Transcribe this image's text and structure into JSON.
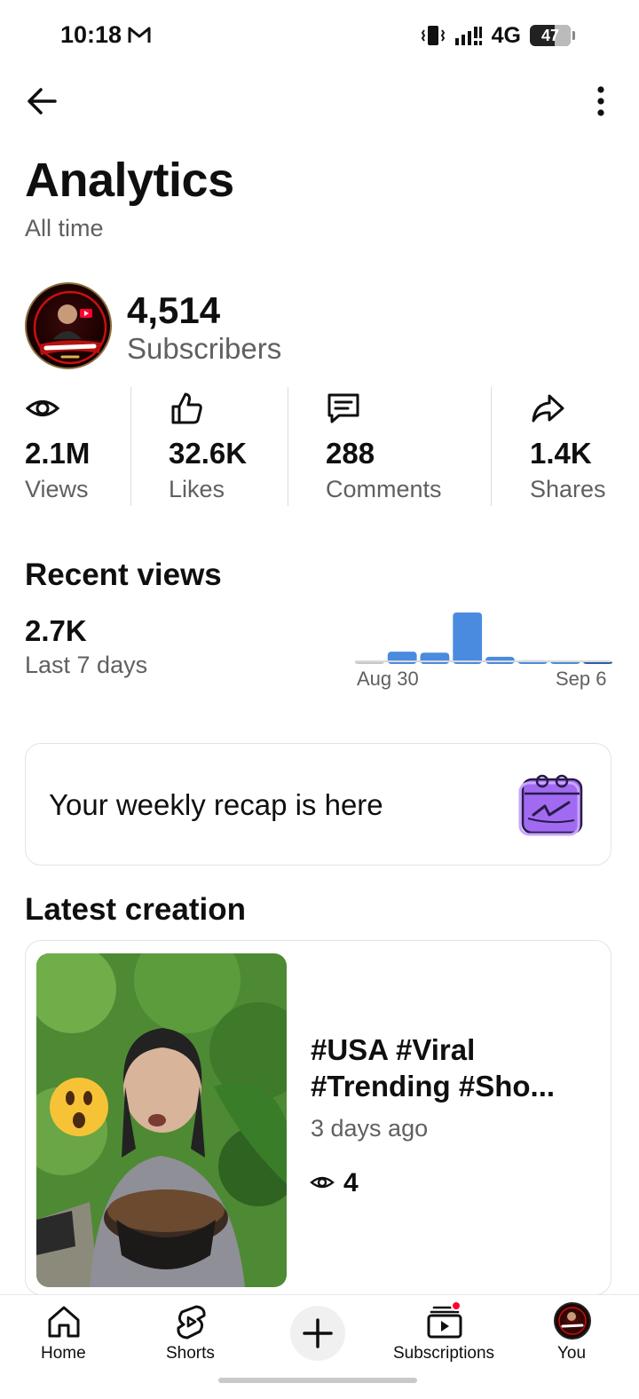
{
  "status_bar": {
    "time": "10:18",
    "network": "4G",
    "battery": "47"
  },
  "page": {
    "title": "Analytics",
    "subtitle": "All time"
  },
  "channel": {
    "subscribers": "4,514",
    "subscribers_label": "Subscribers"
  },
  "metrics": [
    {
      "icon": "eye-icon",
      "value": "2.1M",
      "label": "Views"
    },
    {
      "icon": "thumbs-up-icon",
      "value": "32.6K",
      "label": "Likes"
    },
    {
      "icon": "comment-icon",
      "value": "288",
      "label": "Comments"
    },
    {
      "icon": "share-icon",
      "value": "1.4K",
      "label": "Shares"
    }
  ],
  "recent_views": {
    "title": "Recent views",
    "count": "2.7K",
    "period": "Last 7 days"
  },
  "chart_data": {
    "type": "bar",
    "categories": [
      "1",
      "2",
      "3",
      "4",
      "5",
      "6",
      "7",
      "8"
    ],
    "values": [
      4,
      24,
      22,
      100,
      14,
      7,
      6,
      4
    ],
    "x_tick_labels": [
      "Aug 30",
      "Sep 6"
    ],
    "colors": {
      "bar": "#4a8be0",
      "first": "#c8c8c8",
      "last": "#2b5fab"
    }
  },
  "recap": {
    "text": "Your weekly recap is here",
    "icon": "calendar-check-icon"
  },
  "latest_creation": {
    "title": "Latest creation",
    "video_title": "#USA #Viral #Trending #Sho...",
    "age": "3 days ago",
    "views": "4"
  },
  "nav": {
    "home": "Home",
    "shorts": "Shorts",
    "subscriptions": "Subscriptions",
    "you": "You"
  },
  "colors": {
    "text": "#0f0f0f",
    "secondary": "#606060",
    "accent": "#ff0033",
    "recap_purple": "#a06bf0"
  }
}
